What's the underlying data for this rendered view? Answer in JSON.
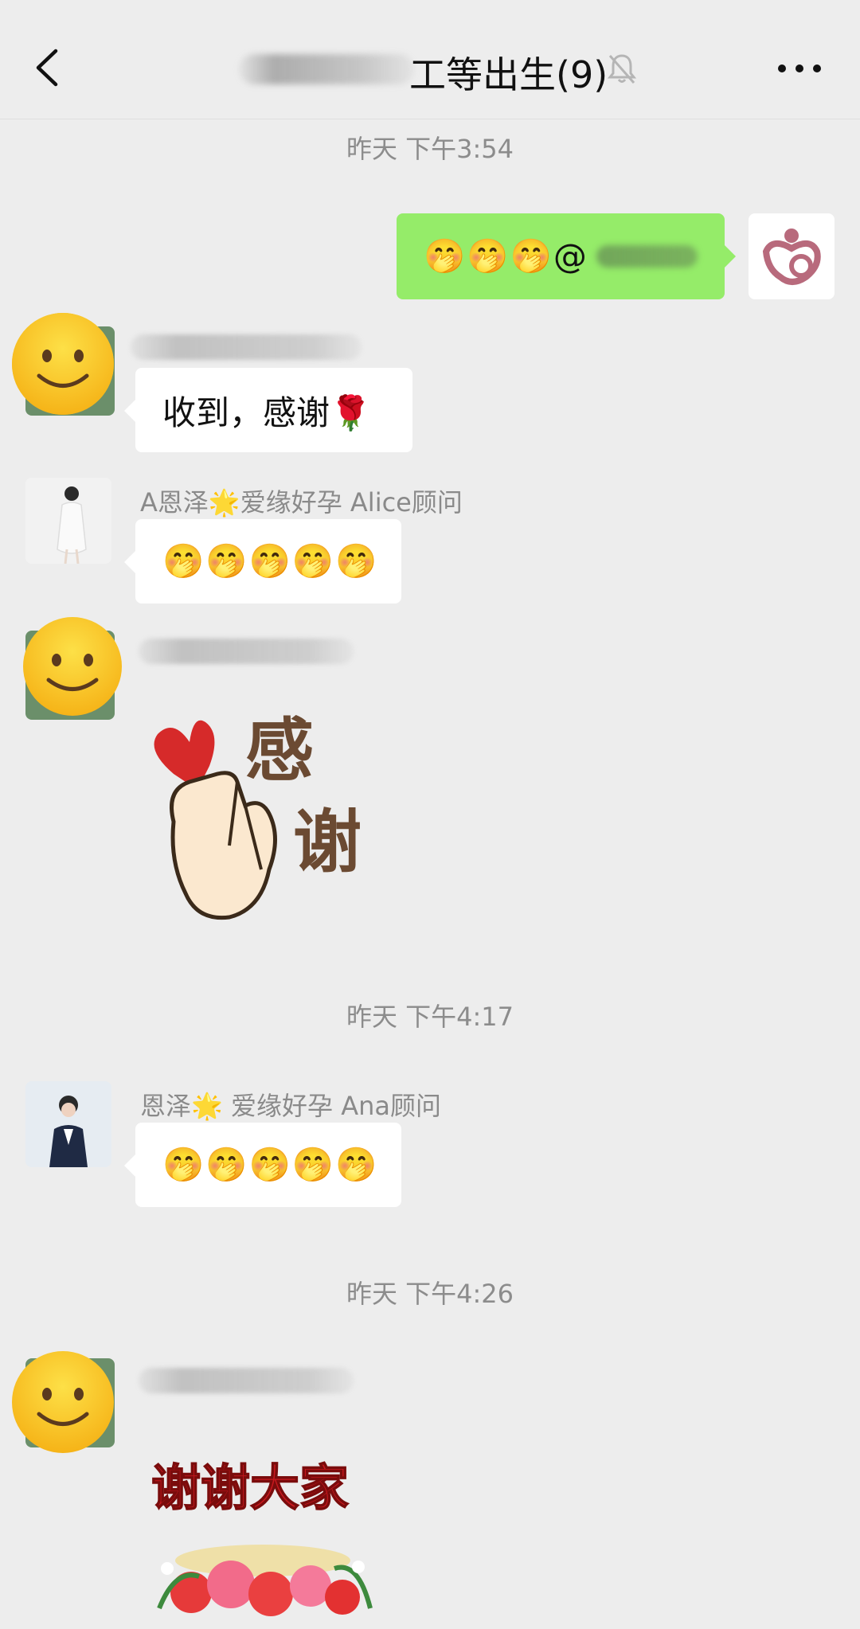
{
  "header": {
    "title": "工等出生(9)",
    "back_icon": "chevron-left-icon",
    "mute_icon": "bell-off-icon",
    "more_icon": "more-horizontal-icon"
  },
  "messages": {
    "ts1": "昨天 下午3:54",
    "self_msg": "🤭🤭🤭@",
    "msg1_text": "收到，感谢🌹",
    "alice_name": "A恩泽🌟爱缘好孕 Alice顾问",
    "alice_text": "🤭🤭🤭🤭🤭",
    "sticker1_text": "感谢",
    "ts2": "昨天 下午4:17",
    "ana_name": "恩泽🌟 爱缘好孕 Ana顾问",
    "ana_text": "🤭🤭🤭🤭🤭",
    "ts3": "昨天 下午4:26",
    "sticker2_text": "谢谢大家"
  },
  "colors": {
    "background": "#ededed",
    "self_bubble": "#95ec69",
    "other_bubble": "#ffffff",
    "timestamp": "#8c8c8c"
  }
}
